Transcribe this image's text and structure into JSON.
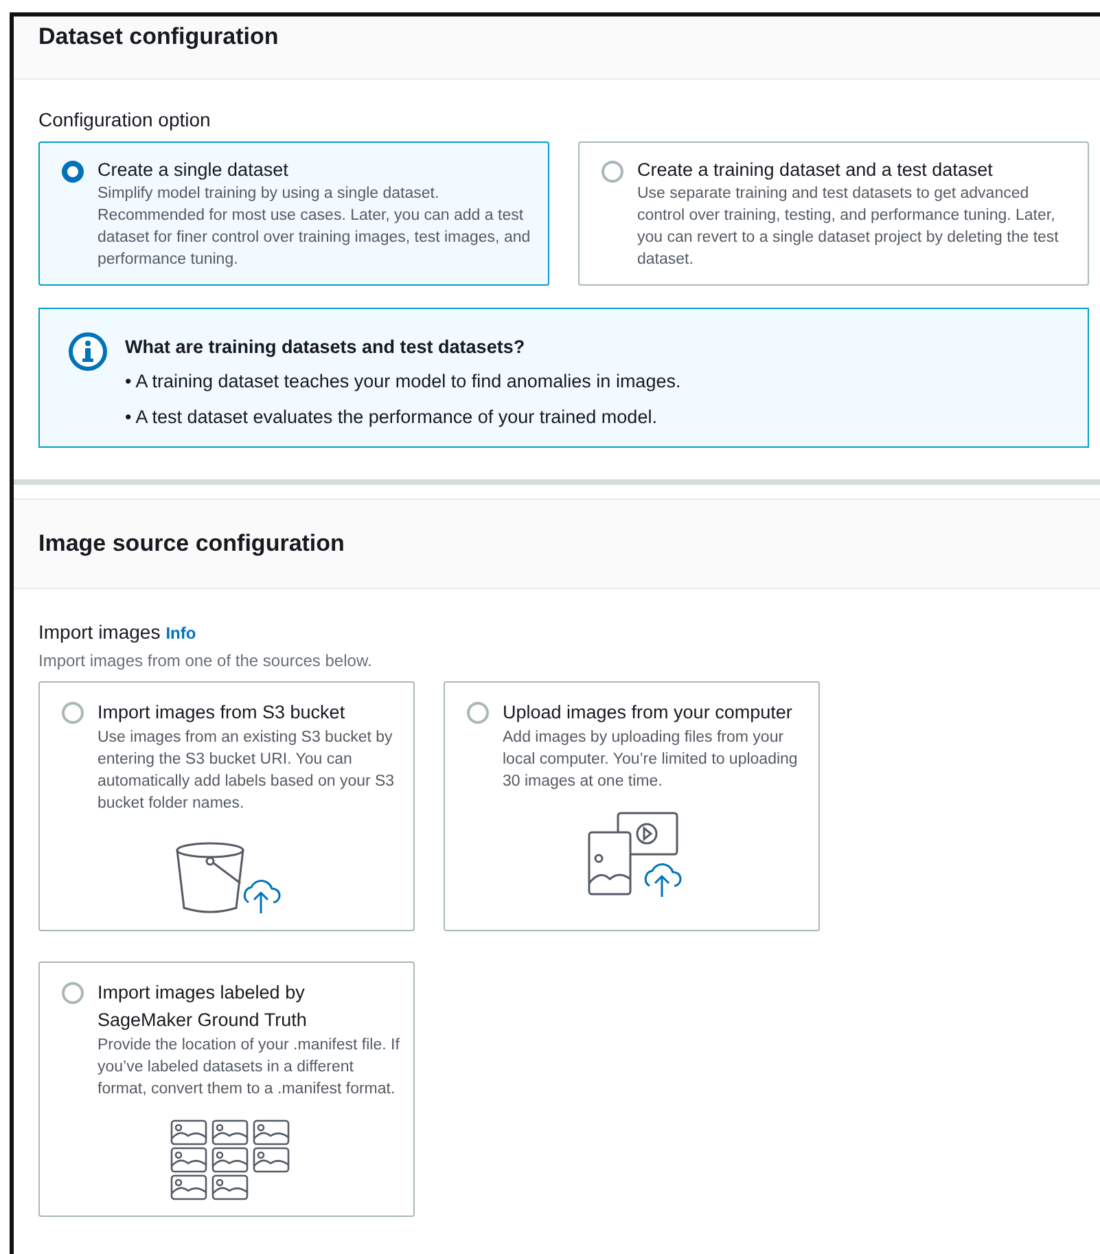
{
  "dataset_configuration": {
    "title": "Dataset configuration",
    "field_label": "Configuration option",
    "options": [
      {
        "title": "Create a single dataset",
        "description": "Simplify model training by using a single dataset. Recommended for most use cases. Later, you can add a test dataset for finer control over training images, test images, and performance tuning.",
        "selected": true
      },
      {
        "title": "Create a training dataset and a test dataset",
        "description": "Use separate training and test datasets to get advanced control over training, testing, and performance tuning. Later, you can revert to a single dataset project by deleting the test dataset.",
        "selected": false
      }
    ],
    "info_box": {
      "title": "What are training datasets and test datasets?",
      "items": [
        "• A training dataset teaches your model to find anomalies in images.",
        "• A test dataset evaluates the performance of your trained model."
      ]
    }
  },
  "image_source_configuration": {
    "title": "Image source configuration",
    "field_label": "Import images",
    "info_link": "Info",
    "field_description": "Import images from one of the sources below.",
    "options": [
      {
        "title": "Import images from S3 bucket",
        "description": "Use images from an existing S3 bucket by entering the S3 bucket URI. You can automatically add labels based on your S3 bucket folder names.",
        "selected": false,
        "kind": "bucket"
      },
      {
        "title": "Upload images from your computer",
        "description": "Add images by uploading files from your local computer. You’re limited to uploading 30 images at one time.",
        "selected": false,
        "kind": "upload"
      },
      {
        "title": "Import images labeled by SageMaker Ground Truth",
        "description": "Provide the location of your .manifest file. If you’ve labeled datasets in a different format, convert them to a .manifest format.",
        "selected": false,
        "kind": "gallery"
      }
    ]
  }
}
